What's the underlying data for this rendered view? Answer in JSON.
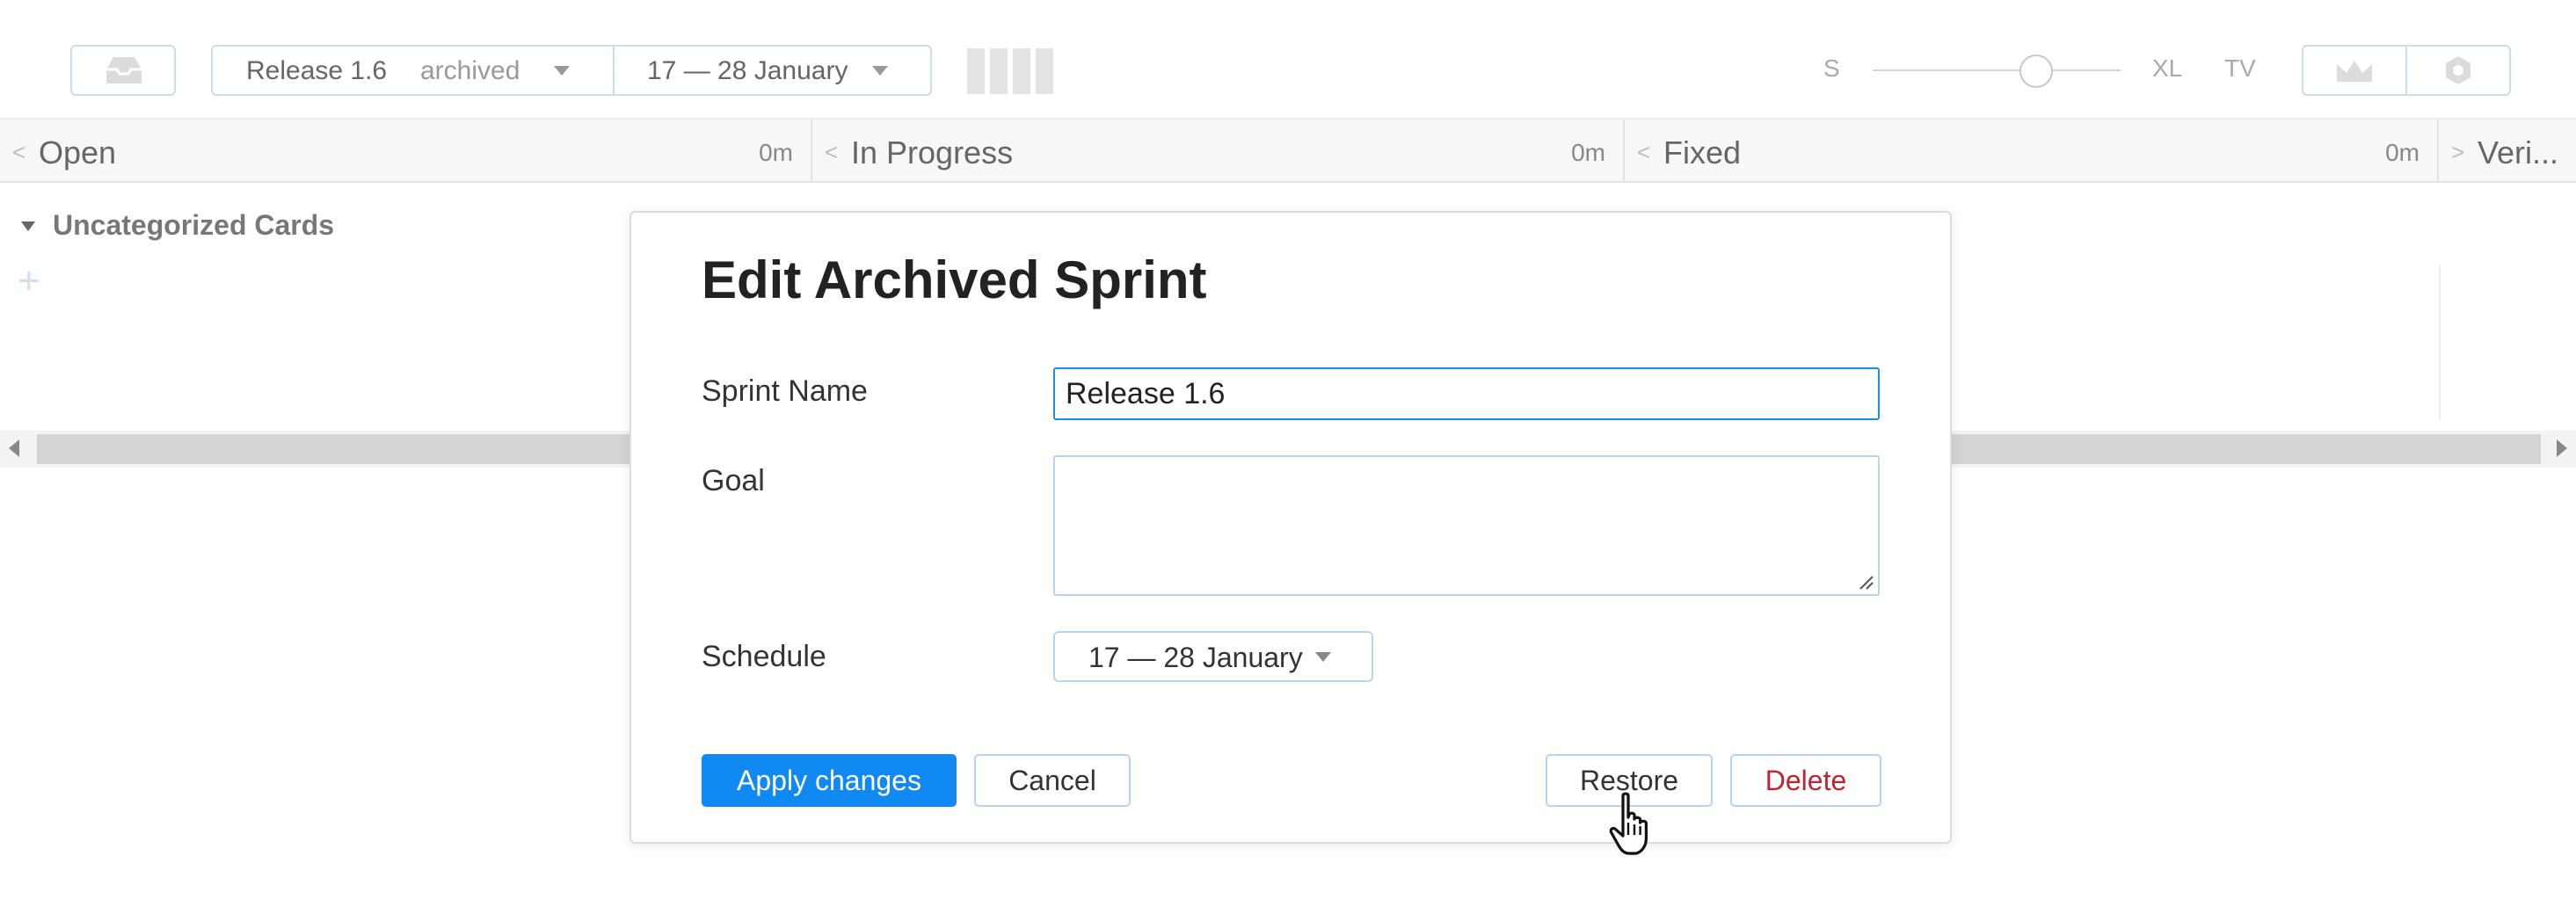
{
  "toolbar": {
    "sprint_name": "Release 1.6",
    "sprint_state": "archived",
    "date_range": "17 — 28 January",
    "size_small": "S",
    "size_xl": "XL",
    "size_tv": "TV",
    "inbox_icon": "inbox-icon",
    "chart_icon": "crown-chart-icon",
    "settings_icon": "settings-hex-icon"
  },
  "columns": [
    {
      "name": "Open",
      "time": "0m"
    },
    {
      "name": "In Progress",
      "time": "0m"
    },
    {
      "name": "Fixed",
      "time": "0m"
    },
    {
      "name": "Veri..."
    }
  ],
  "board": {
    "group_title": "Uncategorized Cards",
    "add_label": "+"
  },
  "modal": {
    "title": "Edit Archived Sprint",
    "sprint_name_label": "Sprint Name",
    "sprint_name_value": "Release 1.6",
    "goal_label": "Goal",
    "goal_value": "",
    "schedule_label": "Schedule",
    "schedule_value": "17 — 28 January",
    "apply_label": "Apply changes",
    "cancel_label": "Cancel",
    "restore_label": "Restore",
    "delete_label": "Delete"
  },
  "colors": {
    "accent": "#1189f2",
    "danger": "#c0242f",
    "border": "#b8d4ee"
  }
}
